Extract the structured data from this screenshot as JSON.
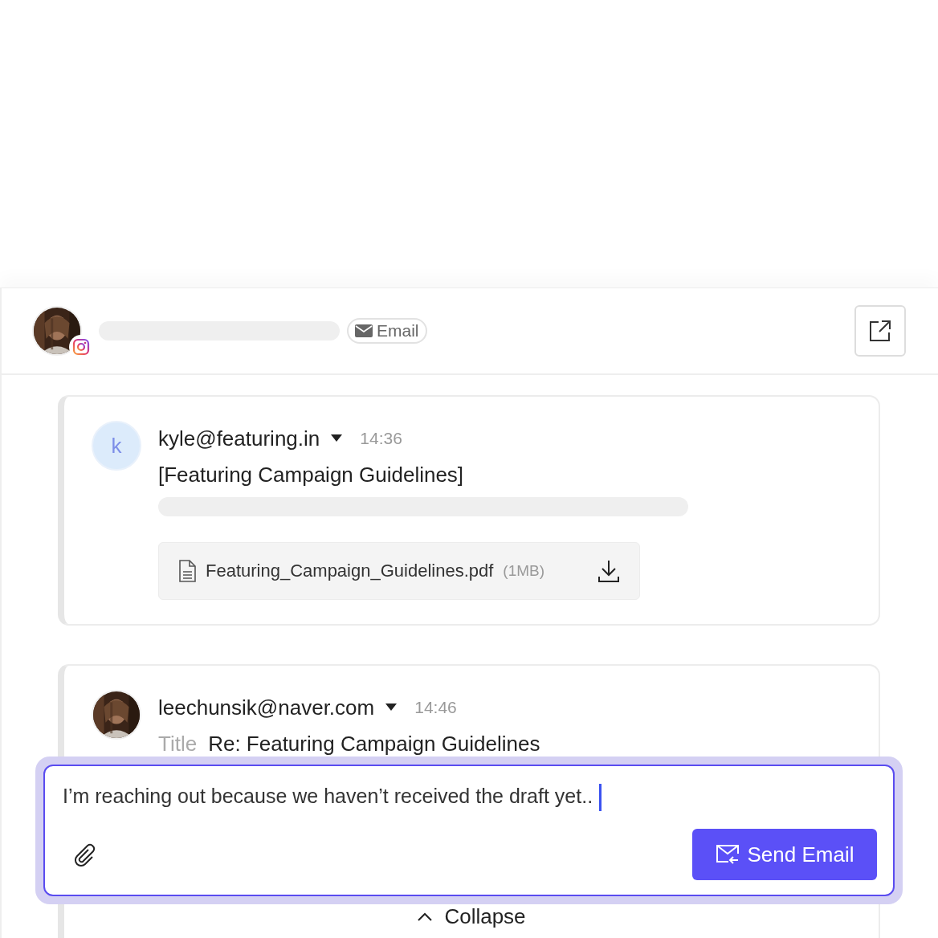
{
  "header": {
    "channel_badge": "Email"
  },
  "messages": [
    {
      "avatar": {
        "kind": "letter",
        "letter": "k"
      },
      "sender": "kyle@featuring.in",
      "time": "14:36",
      "subject": "[Featuring Campaign Guidelines]",
      "attachment": {
        "name": "Featuring_Campaign_Guidelines.pdf",
        "size": "(1MB)"
      }
    },
    {
      "sender": "leechunsik@naver.com",
      "time": "14:46",
      "title_label": "Title",
      "subject": "Re: Featuring Campaign Guidelines"
    }
  ],
  "composer": {
    "value": "I’m reaching out because we haven’t received the draft yet..",
    "send_button": "Send Email"
  },
  "collapse": "Collapse"
}
